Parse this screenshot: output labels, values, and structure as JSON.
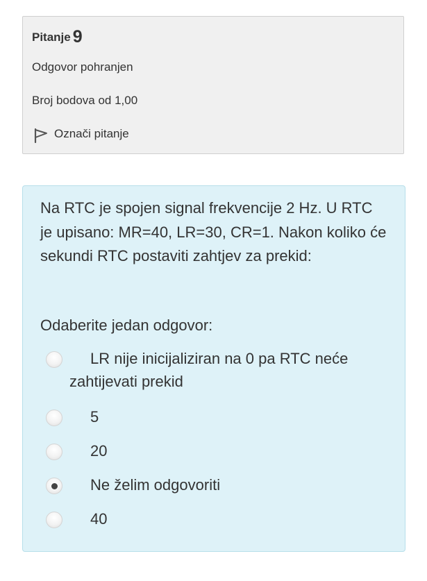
{
  "info": {
    "title_label": "Pitanje",
    "question_number": "9",
    "state": "Odgovor pohranjen",
    "grade": "Broj bodova od 1,00",
    "flag_label": "Označi pitanje"
  },
  "question": {
    "text": "Na RTC je spojen signal frekvencije 2 Hz. U RTC je upisano: MR=40, LR=30, CR=1. Nakon koliko će sekundi RTC postaviti zahtjev za prekid:",
    "prompt": "Odaberite jedan odgovor:",
    "answers": [
      {
        "label": "LR nije inicijaliziran na 0 pa RTC neće zahtijevati prekid",
        "selected": false
      },
      {
        "label": "5",
        "selected": false
      },
      {
        "label": "20",
        "selected": false
      },
      {
        "label": "Ne želim odgovoriti",
        "selected": true
      },
      {
        "label": "40",
        "selected": false
      }
    ]
  },
  "colors": {
    "info_background": "#f0f0f0",
    "content_background": "#def2f8",
    "content_border": "#b7dfea",
    "text": "#333333"
  }
}
